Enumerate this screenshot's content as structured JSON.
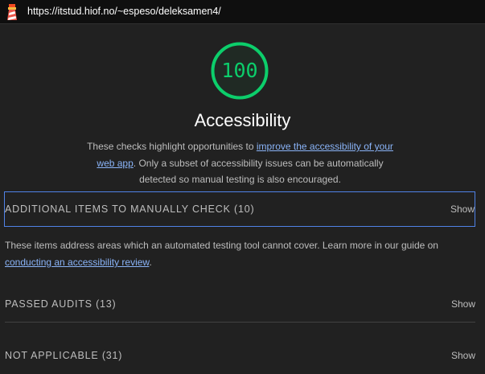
{
  "browser": {
    "url": "https://itstud.hiof.no/~espeso/deleksamen4/"
  },
  "category": {
    "score": "100",
    "title": "Accessibility",
    "description_before": "These checks highlight opportunities to ",
    "description_link": "improve the accessibility of your web app",
    "description_after": ". Only a subset of accessibility issues can be automatically detected so manual testing is also encouraged."
  },
  "groups": {
    "manual": {
      "title": "ADDITIONAL ITEMS TO MANUALLY CHECK (10)",
      "toggle": "Show",
      "description_before": "These items address areas which an automated testing tool cannot cover. Learn more in our guide on ",
      "description_link": "conducting an accessibility review",
      "description_after": "."
    },
    "passed": {
      "title": "PASSED AUDITS (13)",
      "toggle": "Show"
    },
    "not_applicable": {
      "title": "NOT APPLICABLE (31)",
      "toggle": "Show"
    }
  },
  "colors": {
    "pass": "#0cce6b",
    "link": "#8ab4f8",
    "focus_border": "#5082e6"
  },
  "icons": {
    "topbar": "lighthouse-logo-icon"
  }
}
